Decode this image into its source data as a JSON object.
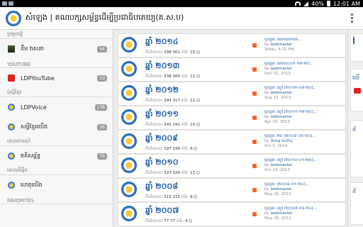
{
  "status": {
    "battery": "40%",
    "time": "12:01 AM"
  },
  "appbar": {
    "title": "សំឡេង | គណបក្សសម្ព័ន្ធដើម្បីប្រជាធិបតេយ្យ(គ.ស.ប)"
  },
  "sidebar": {
    "sections": [
      {
        "header": "ប្រមូលផ្ដុំ",
        "items": [
          {
            "label": "ខឹម វាសនា",
            "count": "54"
          }
        ]
      },
      {
        "header": "YOUTUBE",
        "items": [
          {
            "label": "LDPYouTube",
            "count": "53"
          }
        ]
      },
      {
        "header": "ប៉ុស្តិ៍ខ្មែរ",
        "items": [
          {
            "label": "LDPVoice",
            "count": "138"
          },
          {
            "label": "សម្ដីខ្មែរយើង",
            "count": "36"
          }
        ]
      },
      {
        "header": "គោលការណ៍",
        "items": [
          {
            "label": "គតិសម្ព័ន្ធ",
            "count": "79"
          }
        ]
      },
      {
        "header": "គោលនិម្មិត",
        "items": [
          {
            "label": "ហេតុយើង",
            "count": ""
          }
        ]
      },
      {
        "header": "FAVORITES",
        "items": []
      }
    ]
  },
  "forum": [
    {
      "year": "ឆ្នាំ ២០១៤",
      "stats_label": "តិចនិយាយ:",
      "topics": "298",
      "replies": "301",
      "pages_label": "ទំព័រ:",
      "pages": "10",
      "last_title": "ចូលរួម: ព័ត៌មានអំពីពិធី...",
      "by": "by",
      "author": "webmaster",
      "date": "Today, 5:22 PM"
    },
    {
      "year": "ឆ្នាំ ២០១៣",
      "stats_label": "តិចនិយាយ:",
      "topics": "338",
      "replies": "365",
      "pages_label": "ទំព័រ:",
      "pages": "12",
      "last_title": "ចូលរួម: ព័ត៌មាន(០១-១២-២០...",
      "by": "by",
      "author": "webmaster",
      "date": "Dec 31, 2013"
    },
    {
      "year": "ឆ្នាំ ២០១២",
      "stats_label": "តិចនិយាយ:",
      "topics": "294",
      "replies": "317",
      "pages_label": "ទំព័រ:",
      "pages": "12",
      "last_title": "ចូលរួម: ខៀវ [២០១២-០៨-២៤]...",
      "by": "by",
      "author": "webmaster",
      "date": "Aug 23, 2013"
    },
    {
      "year": "ឆ្នាំ ២០១១",
      "stats_label": "តិចនិយាយ:",
      "topics": "242",
      "replies": "242",
      "pages_label": "ទំព័រ:",
      "pages": "10",
      "last_title": "ចូលរួម: ខៀវ [២០១១-១២-២៤]...",
      "by": "by",
      "author": "webmaster",
      "date": "Apr 15, 2013"
    },
    {
      "year": "ឆ្នាំ ២០០៩",
      "stats_label": "តិចនិយាយ:",
      "topics": "197",
      "replies": "198",
      "pages_label": "ទំព័រ:",
      "pages": "8",
      "last_title": "ចូលរួម: ២០ [២០០៩-០៥-២០]...",
      "by": "by",
      "author": "Vong Vuthy",
      "date": "Oct 3, 2014"
    },
    {
      "year": "ឆ្នាំ ២០១០",
      "stats_label": "តិចនិយាយ:",
      "topics": "323",
      "replies": "326",
      "pages_label": "ទំព័រ:",
      "pages": "13",
      "last_title": "ចូលរួម: ខៀវ [២០១០-០១-២៥]...",
      "by": "by",
      "author": "webmaster",
      "date": "Oct 24, 2013"
    },
    {
      "year": "ឆ្នាំ ២០០៨",
      "stats_label": "តិចនិយាយ:",
      "topics": "215",
      "replies": "215",
      "pages_label": "ទំព័រ:",
      "pages": "9",
      "last_title": "ចូលរួម: [២០០៨-០១-២៤]...",
      "by": "by",
      "author": "webmaster",
      "date": "May 26, 2013"
    },
    {
      "year": "ឆ្នាំ ២០០៧",
      "stats_label": "តិចនិយាយ:",
      "topics": "77",
      "replies": "77",
      "pages_label": "ទំព័រ:",
      "pages": "4",
      "last_title": "ចូលរួម: ខៀវ [២០០៧-០៥-២៤]...",
      "by": "by",
      "author": "webmaster",
      "date": "May 26, 2013"
    }
  ],
  "right_panel": {
    "labels": [
      "ព័",
      "លើ",
      "ព័",
      "ព័"
    ]
  },
  "colors": {
    "accent": "#1d5fa8",
    "rss": "#f26522",
    "youtube": "#dd2222"
  }
}
